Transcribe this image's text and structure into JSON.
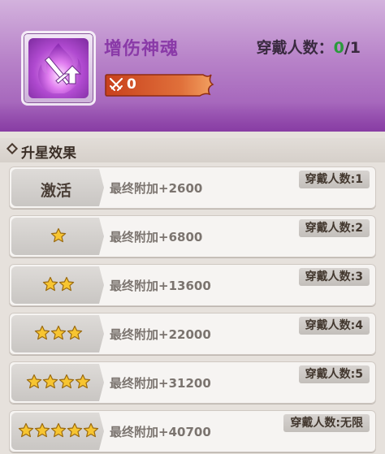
{
  "item": {
    "name": "增伤神魂",
    "wearers_label": "穿戴人数：",
    "wearers_current": "0",
    "wearers_sep": "/",
    "wearers_max": "1",
    "attack_value": "0",
    "icon": "purple-flame-sword-icon"
  },
  "section": {
    "title": "升星效果"
  },
  "rows": [
    {
      "label": "激活",
      "stars": 0,
      "desc": "最终附加+2600",
      "tag": "穿戴人数:1"
    },
    {
      "label": "",
      "stars": 1,
      "desc": "最终附加+6800",
      "tag": "穿戴人数:2"
    },
    {
      "label": "",
      "stars": 2,
      "desc": "最终附加+13600",
      "tag": "穿戴人数:3"
    },
    {
      "label": "",
      "stars": 3,
      "desc": "最终附加+22000",
      "tag": "穿戴人数:4"
    },
    {
      "label": "",
      "stars": 4,
      "desc": "最终附加+31200",
      "tag": "穿戴人数:5"
    },
    {
      "label": "",
      "stars": 5,
      "desc": "最终附加+40700",
      "tag": "穿戴人数:无限"
    }
  ],
  "colors": {
    "accent_purple": "#8a3aa8",
    "current_green": "#2b9a3c",
    "attack_bar": "#d8592a",
    "star_gold": "#f7c531"
  }
}
